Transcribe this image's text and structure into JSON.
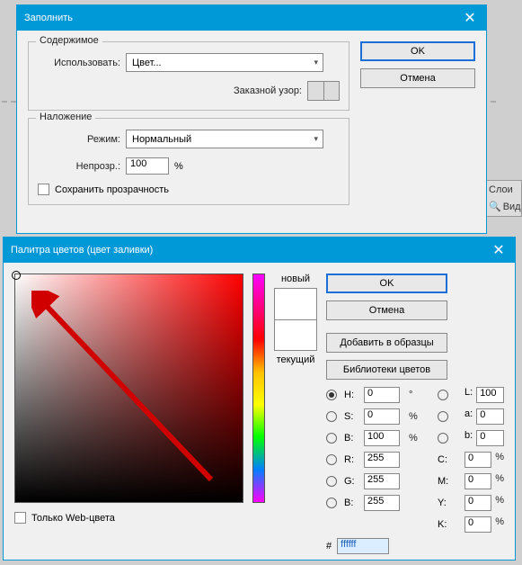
{
  "fill": {
    "title": "Заполнить",
    "contents": {
      "legend": "Содержимое",
      "use_label": "Использовать:",
      "use_value": "Цвет...",
      "pattern_label": "Заказной узор:"
    },
    "blend": {
      "legend": "Наложение",
      "mode_label": "Режим:",
      "mode_value": "Нормальный",
      "opacity_label": "Непрозр.:",
      "opacity_value": "100",
      "opacity_unit": "%",
      "preserve_label": "Сохранить прозрачность"
    },
    "ok": "OK",
    "cancel": "Отмена"
  },
  "picker": {
    "title": "Палитра цветов (цвет заливки)",
    "new_label": "новый",
    "current_label": "текущий",
    "ok": "OK",
    "cancel": "Отмена",
    "add_swatches": "Добавить в образцы",
    "libraries": "Библиотеки цветов",
    "webonly": "Только Web-цвета",
    "hex_prefix": "#",
    "hex_value": "ffffff",
    "fields": {
      "H": {
        "label": "H:",
        "value": "0",
        "unit": "°"
      },
      "S": {
        "label": "S:",
        "value": "0",
        "unit": "%"
      },
      "Bv": {
        "label": "B:",
        "value": "100",
        "unit": "%"
      },
      "R": {
        "label": "R:",
        "value": "255",
        "unit": ""
      },
      "G": {
        "label": "G:",
        "value": "255",
        "unit": ""
      },
      "Br": {
        "label": "B:",
        "value": "255",
        "unit": ""
      },
      "L": {
        "label": "L:",
        "value": "100",
        "unit": ""
      },
      "a": {
        "label": "a:",
        "value": "0",
        "unit": ""
      },
      "bl": {
        "label": "b:",
        "value": "0",
        "unit": ""
      },
      "C": {
        "label": "C:",
        "value": "0",
        "unit": "%"
      },
      "M": {
        "label": "M:",
        "value": "0",
        "unit": "%"
      },
      "Y": {
        "label": "Y:",
        "value": "0",
        "unit": "%"
      },
      "K": {
        "label": "K:",
        "value": "0",
        "unit": "%"
      }
    }
  },
  "panel": {
    "layers": "Слои",
    "kind": "Вид"
  }
}
